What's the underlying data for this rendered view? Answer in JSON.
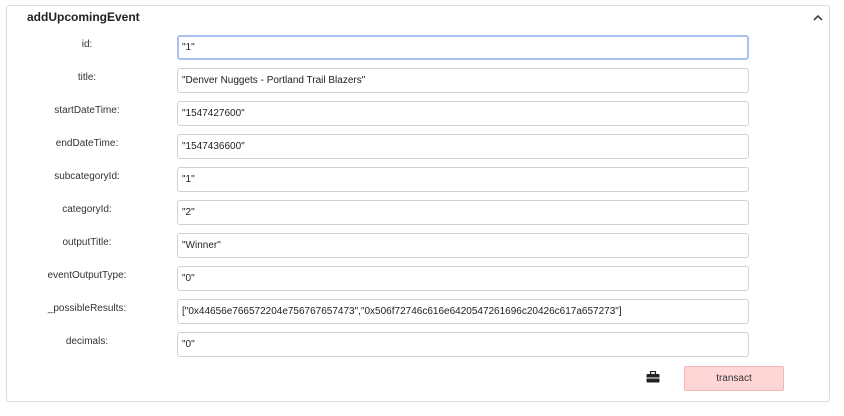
{
  "function": {
    "name": "addUpcomingEvent"
  },
  "fields": [
    {
      "label": "id:",
      "value": "\"1\""
    },
    {
      "label": "title:",
      "value": "\"Denver Nuggets - Portland Trail Blazers\""
    },
    {
      "label": "startDateTime:",
      "value": "\"1547427600\""
    },
    {
      "label": "endDateTime:",
      "value": "\"1547436600\""
    },
    {
      "label": "subcategoryId:",
      "value": "\"1\""
    },
    {
      "label": "categoryId:",
      "value": "\"2\""
    },
    {
      "label": "outputTitle:",
      "value": "\"Winner\""
    },
    {
      "label": "eventOutputType:",
      "value": "\"0\""
    },
    {
      "label": "_possibleResults:",
      "value": "[\"0x44656e766572204e756767657473\",\"0x506f72746c616e6420547261696c20426c617a657273\"]"
    },
    {
      "label": "decimals:",
      "value": "\"0\""
    }
  ],
  "actions": {
    "transact_label": "transact",
    "briefcase_icon": "briefcase-icon",
    "collapse_icon": "chevron-up-icon"
  },
  "colors": {
    "transact_bg": "#ffd6d6",
    "focus_border": "#a9c2f2"
  }
}
